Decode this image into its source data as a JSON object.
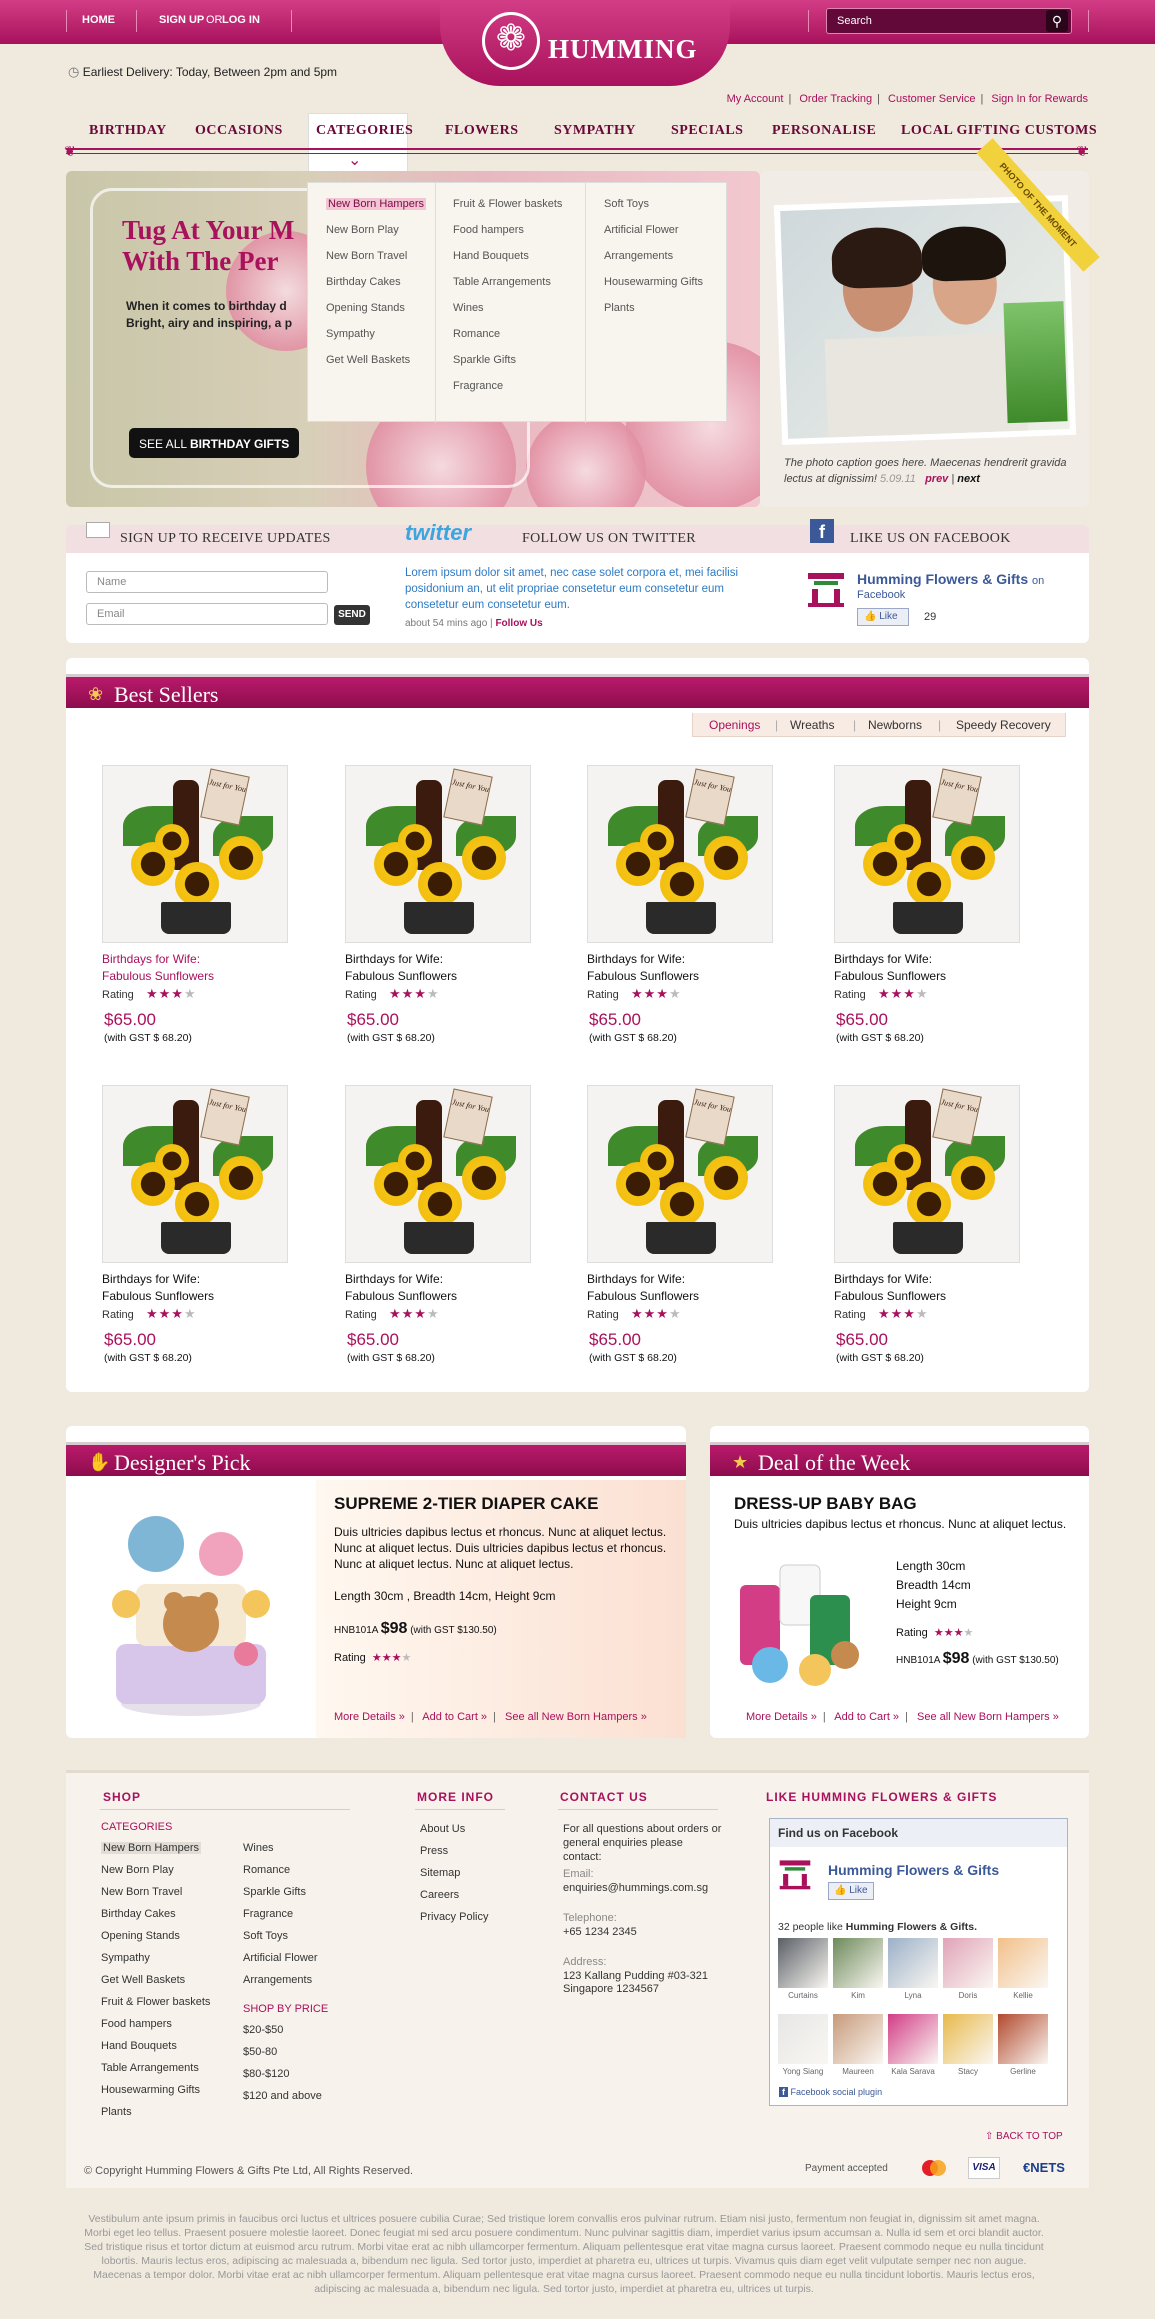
{
  "topbar": {
    "home": "HOME",
    "signup": "SIGN UP",
    "or": "OR",
    "login": "LOG IN",
    "search_placeholder": "Search",
    "logo_text": "HUMMING"
  },
  "delivery": "Earliest Delivery: Today, Between 2pm and 5pm",
  "account_links": [
    "My Account",
    "Order Tracking",
    "Customer Service",
    "Sign In for Rewards"
  ],
  "nav": [
    "BIRTHDAY",
    "OCCASIONS",
    "CATEGORIES",
    "FLOWERS",
    "SYMPATHY",
    "SPECIALS",
    "PERSONALISE",
    "LOCAL GIFTING CUSTOMS"
  ],
  "dropdown": {
    "col1": [
      "New Born Hampers",
      "New Born Play",
      "New Born Travel",
      "Birthday Cakes",
      "Opening Stands",
      "Sympathy",
      "Get Well Baskets"
    ],
    "col2": [
      "Fruit & Flower baskets",
      "Food hampers",
      "Hand Bouquets",
      "Table Arrangements",
      "Wines",
      "Romance",
      "Sparkle Gifts",
      "Fragrance"
    ],
    "col3": [
      "Soft Toys",
      "Artificial Flower",
      "Arrangements",
      "Housewarming Gifts",
      "Plants"
    ]
  },
  "hero": {
    "title_line1": "Tug At Your M",
    "title_line2": "With The Per",
    "text_line1": "When it comes to birthday d",
    "text_line2": "Bright, airy and inspiring, a p",
    "btn_prefix": "SEE ALL",
    "btn_bold": "BIRTHDAY GIFTS"
  },
  "moment": {
    "banner": "PHOTO OF THE MOMENT",
    "caption": "The photo caption goes here. Maecenas hendrerit gravida lectus at dignissim!",
    "date": "5.09.11",
    "prev": "prev",
    "next": "next"
  },
  "social": {
    "signup_title": "SIGN UP TO RECEIVE UPDATES",
    "twitter_logo": "twitter",
    "twitter_title": "FOLLOW US ON TWITTER",
    "fb_title": "LIKE US ON FACEBOOK",
    "name_placeholder": "Name",
    "email_placeholder": "Email",
    "send": "SEND",
    "tweet": "Lorem ipsum dolor sit amet, nec case solet corpora et, mei facilisi posidonium an, ut elit propriae consetetur eum consetetur eum consetetur eum consetetur eum.",
    "tweet_time": "about 54 mins ago",
    "follow_us": "Follow Us",
    "fb_page": "Humming Flowers & Gifts",
    "fb_on": "on",
    "fb_sub": "Facebook",
    "fb_like": "Like",
    "fb_count": "29"
  },
  "best_sellers": {
    "title": "Best Sellers",
    "tabs": [
      "Openings",
      "Wreaths",
      "Newborns",
      "Speedy Recovery"
    ],
    "products": [
      {
        "name1": "Birthdays for Wife:",
        "name2": "Fabulous Sunflowers",
        "rating_label": "Rating",
        "price": "$65.00",
        "gst": "(with GST $ 68.20)",
        "rating": 3
      },
      {
        "name1": "Birthdays for Wife:",
        "name2": "Fabulous Sunflowers",
        "rating_label": "Rating",
        "price": "$65.00",
        "gst": "(with GST $ 68.20)",
        "rating": 3
      },
      {
        "name1": "Birthdays for Wife:",
        "name2": "Fabulous Sunflowers",
        "rating_label": "Rating",
        "price": "$65.00",
        "gst": "(with GST $ 68.20)",
        "rating": 3
      },
      {
        "name1": "Birthdays for Wife:",
        "name2": "Fabulous Sunflowers",
        "rating_label": "Rating",
        "price": "$65.00",
        "gst": "(with GST $ 68.20)",
        "rating": 3
      },
      {
        "name1": "Birthdays for Wife:",
        "name2": "Fabulous Sunflowers",
        "rating_label": "Rating",
        "price": "$65.00",
        "gst": "(with GST $ 68.20)",
        "rating": 3
      },
      {
        "name1": "Birthdays for Wife:",
        "name2": "Fabulous Sunflowers",
        "rating_label": "Rating",
        "price": "$65.00",
        "gst": "(with GST $ 68.20)",
        "rating": 3
      },
      {
        "name1": "Birthdays for Wife:",
        "name2": "Fabulous Sunflowers",
        "rating_label": "Rating",
        "price": "$65.00",
        "gst": "(with GST $ 68.20)",
        "rating": 3
      },
      {
        "name1": "Birthdays for Wife:",
        "name2": "Fabulous Sunflowers",
        "rating_label": "Rating",
        "price": "$65.00",
        "gst": "(with GST $ 68.20)",
        "rating": 3
      }
    ],
    "card_text": "Just for You"
  },
  "designers_pick": {
    "title": "Designer's Pick",
    "product": "SUPREME 2-TIER DIAPER CAKE",
    "desc": "Duis ultricies dapibus lectus et rhoncus. Nunc at aliquet lectus. Nunc at aliquet lectus. Duis ultricies dapibus lectus et rhoncus. Nunc at aliquet lectus. Nunc at aliquet lectus.",
    "dims": "Length 30cm , Breadth 14cm, Height 9cm",
    "code": "HNB101A",
    "price": "$98",
    "gst": "(with GST $130.50)",
    "rating_label": "Rating",
    "links": [
      "More Details »",
      "Add to Cart »",
      "See all New Born Hampers »"
    ]
  },
  "deal": {
    "title": "Deal of the Week",
    "product": "DRESS-UP BABY BAG",
    "desc": "Duis ultricies dapibus lectus et rhoncus. Nunc at aliquet lectus.",
    "length": "Length 30cm",
    "breadth": "Breadth 14cm",
    "height": "Height 9cm",
    "rating_label": "Rating",
    "code": "HNB101A",
    "price": "$98",
    "gst": "(with GST $130.50)",
    "links": [
      "More Details »",
      "Add to Cart »",
      "See all New Born Hampers »"
    ]
  },
  "footer": {
    "shop": "SHOP",
    "categories": "CATEGORIES",
    "cat_col1": [
      "New Born Hampers",
      "New Born Play",
      "New Born Travel",
      "Birthday Cakes",
      "Opening Stands",
      "Sympathy",
      "Get Well Baskets",
      "Fruit & Flower baskets",
      "Food hampers",
      "Hand Bouquets",
      "Table Arrangements",
      "Housewarming Gifts",
      "Plants"
    ],
    "cat_col2": [
      "Wines",
      "Romance",
      "Sparkle Gifts",
      "Fragrance",
      "Soft Toys",
      "Artificial Flower",
      "Arrangements"
    ],
    "shop_by_price": "SHOP BY PRICE",
    "prices": [
      "$20-$50",
      "$50-80",
      "$80-$120",
      "$120 and above"
    ],
    "more_info": "MORE INFO",
    "info_links": [
      "About Us",
      "Press",
      "Sitemap",
      "Careers",
      "Privacy Policy"
    ],
    "contact_us": "CONTACT US",
    "contact_intro": "For all questions about orders or general enquiries please contact:",
    "email_label": "Email:",
    "email": "enquiries@hummings.com.sg",
    "tel_label": "Telephone:",
    "tel": "+65 1234 2345",
    "addr_label": "Address:",
    "addr1": "123 Kallang Pudding #03-321",
    "addr2": "Singapore 1234567",
    "like_title": "LIKE HUMMING FLOWERS & GIFTS",
    "fb_box_title": "Find us on Facebook",
    "fb_page": "Humming Flowers & Gifts",
    "fb_like": "Like",
    "fb_people_prefix": "32 people like",
    "fb_people_page": "Humming Flowers & Gifts.",
    "fans": [
      "Curtains",
      "Kim",
      "Lyna",
      "Doris",
      "Kellie",
      "Yong Siang",
      "Maureen",
      "Kala Sarava",
      "Stacy",
      "Gerline"
    ],
    "fb_plugin": "Facebook social plugin",
    "back_top": "BACK TO TOP",
    "copyright": "© Copyright Humming Flowers & Gifts Pte Ltd, All Rights Reserved.",
    "payment": "Payment accepted",
    "cards": [
      "MasterCard",
      "VISA",
      "NETS"
    ],
    "lorem": "Vestibulum ante ipsum primis in faucibus orci luctus et ultrices posuere cubilia Curae; Sed tristique lorem convallis eros pulvinar rutrum. Etiam nisi justo, fermentum non feugiat in, dignissim sit amet magna. Morbi eget leo tellus. Praesent posuere molestie laoreet. Donec feugiat mi sed arcu posuere condimentum. Nunc pulvinar sagittis diam, imperdiet varius ipsum accumsan a. Nulla id sem et orci blandit auctor. Sed tristique risus et tortor dictum at euismod arcu rutrum. Morbi vitae erat ac nibh ullamcorper fermentum. Aliquam pellentesque erat vitae magna cursus laoreet. Praesent commodo neque eu nulla tincidunt lobortis. Mauris lectus eros, adipiscing ac malesuada a, bibendum nec ligula. Sed tortor justo, imperdiet at pharetra eu, ultrices ut turpis. Vivamus quis diam eget velit vulputate semper nec non augue. Maecenas a tempor dolor. Morbi vitae erat ac nibh ullamcorper fermentum. Aliquam pellentesque erat vitae magna cursus laoreet. Praesent commodo neque eu nulla tincidunt lobortis. Mauris lectus eros, adipiscing ac malesuada a, bibendum nec ligula. Sed tortor justo, imperdiet at pharetra eu, ultrices ut turpis."
  },
  "colors": {
    "brand": "#a8115c",
    "brand_light": "#d23d86",
    "background": "#efe9de",
    "facebook": "#3b5998",
    "twitter": "#3aa6dd"
  }
}
